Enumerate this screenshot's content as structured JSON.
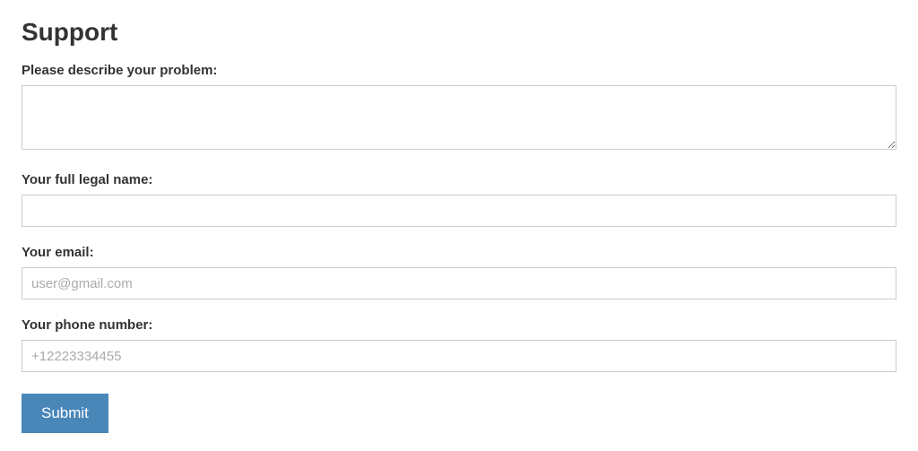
{
  "page": {
    "title": "Support"
  },
  "form": {
    "problem": {
      "label": "Please describe your problem:",
      "value": ""
    },
    "name": {
      "label": "Your full legal name:",
      "value": ""
    },
    "email": {
      "label": "Your email:",
      "placeholder": "user@gmail.com",
      "value": ""
    },
    "phone": {
      "label": "Your phone number:",
      "placeholder": "+12223334455",
      "value": ""
    },
    "submit_label": "Submit"
  }
}
